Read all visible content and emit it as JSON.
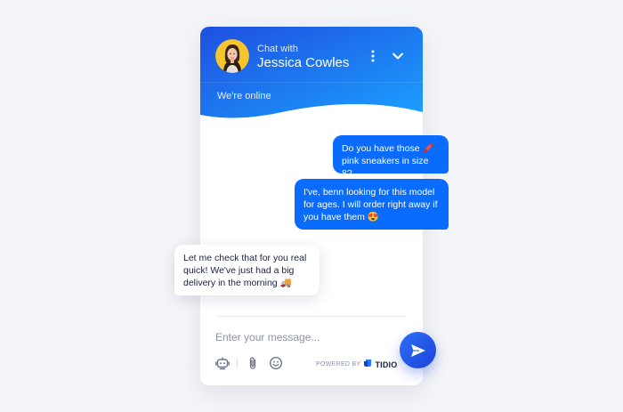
{
  "header": {
    "chat_with_label": "Chat with",
    "agent_name": "Jessica Cowles",
    "status": "We're online"
  },
  "icons": {
    "menu": "vertical-dots-icon",
    "minimize": "chevron-down-icon",
    "bot": "bot-icon",
    "attachment": "paperclip-icon",
    "emoji": "smiley-icon",
    "send": "paper-plane-icon"
  },
  "messages": [
    {
      "from": "visitor",
      "text": "Do you have those 🖍️ pink sneakers in size 8?"
    },
    {
      "from": "visitor",
      "text": "I've, benn looking for this model for ages. I will order right away if you have them 😍"
    },
    {
      "from": "agent",
      "text": "Let me check that for you real quick! We've just had a big delivery in the morning 🚚"
    }
  ],
  "composer": {
    "placeholder": "Enter your message..."
  },
  "footer": {
    "powered_by": "POWERED BY",
    "brand": "TIDIO"
  },
  "colors": {
    "header_gradient_start": "#1f4fe0",
    "header_gradient_end": "#1ba0ff",
    "bubble_out": "#0a6cff",
    "send_button": "#2c6ff7",
    "background": "#f4f5f8"
  }
}
